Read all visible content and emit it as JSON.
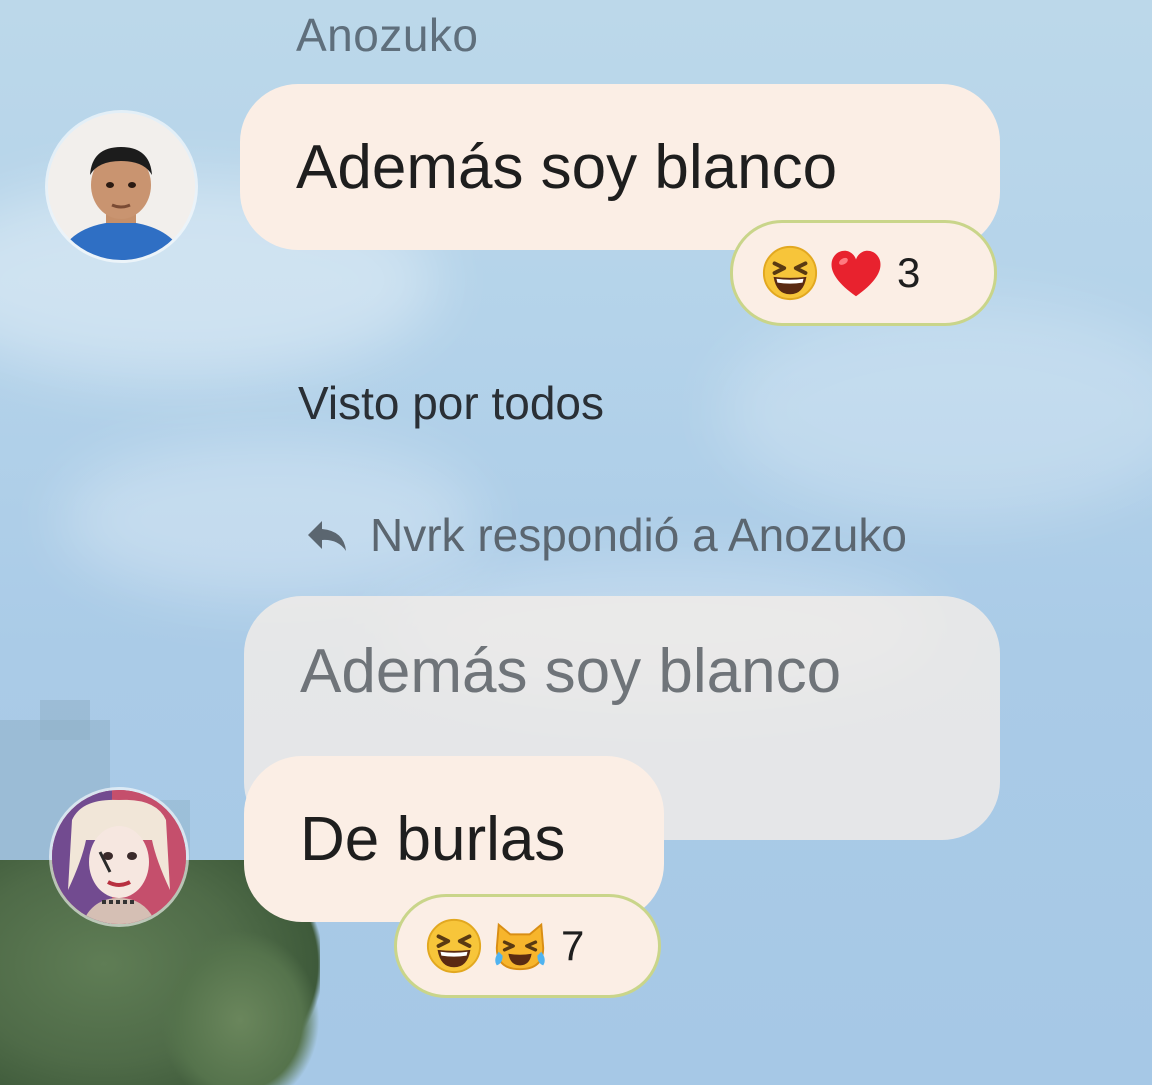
{
  "chat": {
    "messages": [
      {
        "sender": "Anozuko",
        "text": "Además soy blanco",
        "reactions": {
          "emojis": [
            "grinning-squinting-face",
            "red-heart"
          ],
          "count": "3"
        }
      },
      {
        "reply_header": "Nvrk respondió a Anozuko",
        "quoted_text": "Además soy blanco",
        "text": "De burlas",
        "reactions": {
          "emojis": [
            "grinning-squinting-face",
            "cat-with-tears-of-joy"
          ],
          "count": "7"
        }
      }
    ],
    "seen_status": "Visto por todos"
  },
  "colors": {
    "bubble": "#fbeee5",
    "reaction_border": "#c9d58a",
    "sky": "#b4d3ea"
  }
}
